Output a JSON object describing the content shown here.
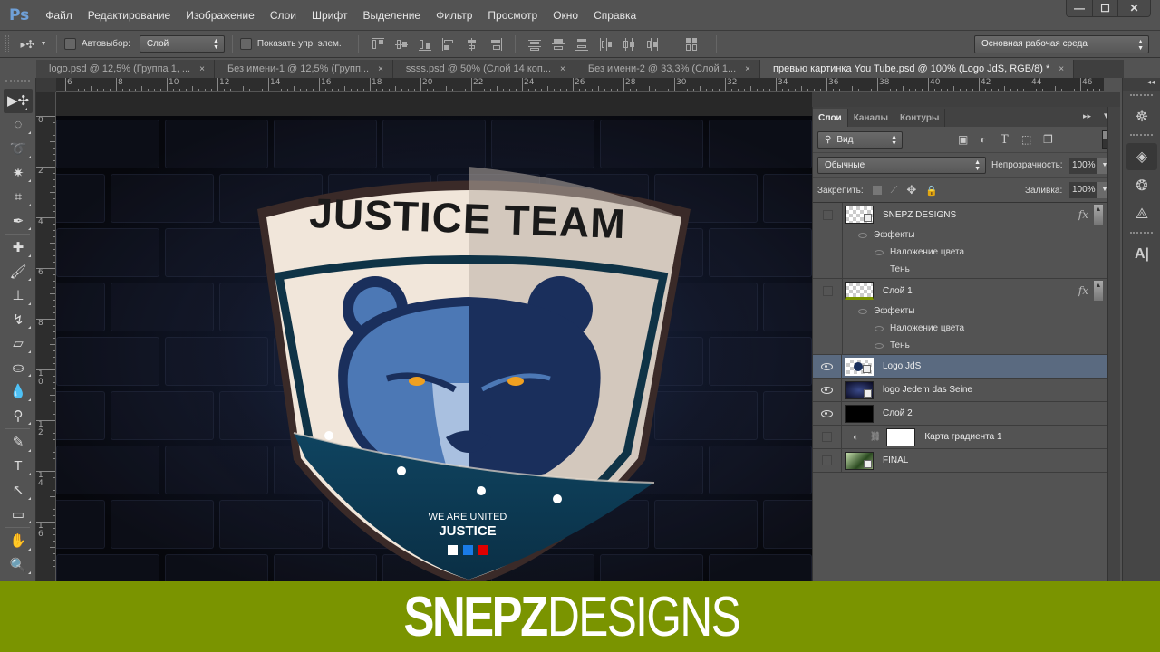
{
  "app": {
    "logo": "Ps",
    "menu": [
      "Файл",
      "Редактирование",
      "Изображение",
      "Слои",
      "Шрифт",
      "Выделение",
      "Фильтр",
      "Просмотр",
      "Окно",
      "Справка"
    ],
    "window_controls": {
      "minimize": "—",
      "maximize": "☐",
      "close": "✕"
    }
  },
  "options_bar": {
    "autoselect_label": "Автовыбор:",
    "autoselect_value": "Слой",
    "show_transform_label": "Показать упр. элем.",
    "workspace_value": "Основная рабочая среда"
  },
  "tabs": [
    {
      "label": "logo.psd @ 12,5% (Группа 1, ...",
      "active": false
    },
    {
      "label": "Без имени-1 @ 12,5% (Групп...",
      "active": false
    },
    {
      "label": "ssss.psd @ 50% (Слой 14 коп...",
      "active": false
    },
    {
      "label": "Без имени-2 @ 33,3% (Слой 1...",
      "active": false
    },
    {
      "label": "превью картинка You Tube.psd @ 100% (Logo JdS, RGB/8) *",
      "active": true
    }
  ],
  "tab_close": "×",
  "rulers": {
    "horizontal": [
      "6",
      "8",
      "10",
      "12",
      "14",
      "16",
      "18",
      "20",
      "22",
      "24",
      "26",
      "28",
      "30",
      "32",
      "34",
      "36",
      "38",
      "40",
      "42",
      "44",
      "46"
    ],
    "vertical": [
      "0",
      "2",
      "4",
      "6",
      "8",
      "10",
      "12",
      "14",
      "16"
    ]
  },
  "tools": [
    {
      "name": "move-tool",
      "glyph": "▶✣",
      "active": true
    },
    {
      "name": "marquee-tool",
      "glyph": "◌"
    },
    {
      "name": "lasso-tool",
      "glyph": "➰"
    },
    {
      "name": "magic-wand-tool",
      "glyph": "✷"
    },
    {
      "name": "crop-tool",
      "glyph": "⌗"
    },
    {
      "name": "eyedropper-tool",
      "glyph": "✒"
    },
    {
      "name": "healing-brush-tool",
      "glyph": "✚"
    },
    {
      "name": "brush-tool",
      "glyph": "🖌"
    },
    {
      "name": "clone-stamp-tool",
      "glyph": "⊥"
    },
    {
      "name": "history-brush-tool",
      "glyph": "↯"
    },
    {
      "name": "eraser-tool",
      "glyph": "▱"
    },
    {
      "name": "paint-bucket-tool",
      "glyph": "⛀"
    },
    {
      "name": "blur-tool",
      "glyph": "💧"
    },
    {
      "name": "dodge-tool",
      "glyph": "⚲"
    },
    {
      "name": "pen-tool",
      "glyph": "✎"
    },
    {
      "name": "type-tool",
      "glyph": "T"
    },
    {
      "name": "path-selection-tool",
      "glyph": "↖"
    },
    {
      "name": "rectangle-tool",
      "glyph": "▭"
    },
    {
      "name": "hand-tool",
      "glyph": "✋"
    },
    {
      "name": "zoom-tool",
      "glyph": "🔍"
    },
    {
      "name": "color-swatches",
      "glyph": "◩ ⇄"
    }
  ],
  "artwork": {
    "title": "JUSTICE TEAM",
    "tagline": "WE ARE UNITED",
    "subtitle": "JUSTICE",
    "flag_colors": [
      "#ffffff",
      "#1a7be8",
      "#e00000"
    ],
    "shield_border": "#3a2a28",
    "shield_cream": "#f1e6da",
    "shield_teal": "#0f4460",
    "bear_light": "#4c78b5",
    "bear_dark": "#1a2f5c",
    "eye_color": "#f0a020"
  },
  "layers_panel": {
    "tabs": [
      "Слои",
      "Каналы",
      "Контуры"
    ],
    "filter_label": "Вид",
    "blend_mode": "Обычные",
    "opacity_label": "Непрозрачность:",
    "opacity_value": "100%",
    "lock_label": "Закрепить:",
    "fill_label": "Заливка:",
    "fill_value": "100%",
    "fx_label": "fx",
    "layers": [
      {
        "name": "SNEPZ DESIGNS",
        "visible": false,
        "fx": true,
        "effects_label": "Эффекты",
        "effects": [
          "Наложение цвета",
          "Тень"
        ]
      },
      {
        "name": "Слой 1",
        "visible": false,
        "fx": true,
        "effects_label": "Эффекты",
        "effects": [
          "Наложение цвета",
          "Тень"
        ]
      },
      {
        "name": "Logo JdS",
        "visible": true,
        "selected": true
      },
      {
        "name": "logo Jedem das Seine",
        "visible": true
      },
      {
        "name": "Слой 2",
        "visible": true
      },
      {
        "name": "Карта градиента 1",
        "visible": false
      },
      {
        "name": "FINAL",
        "visible": false
      }
    ]
  },
  "banner": {
    "bold": "SNEPZ",
    "thin": "DESIGNS",
    "color": "#7a9400"
  }
}
